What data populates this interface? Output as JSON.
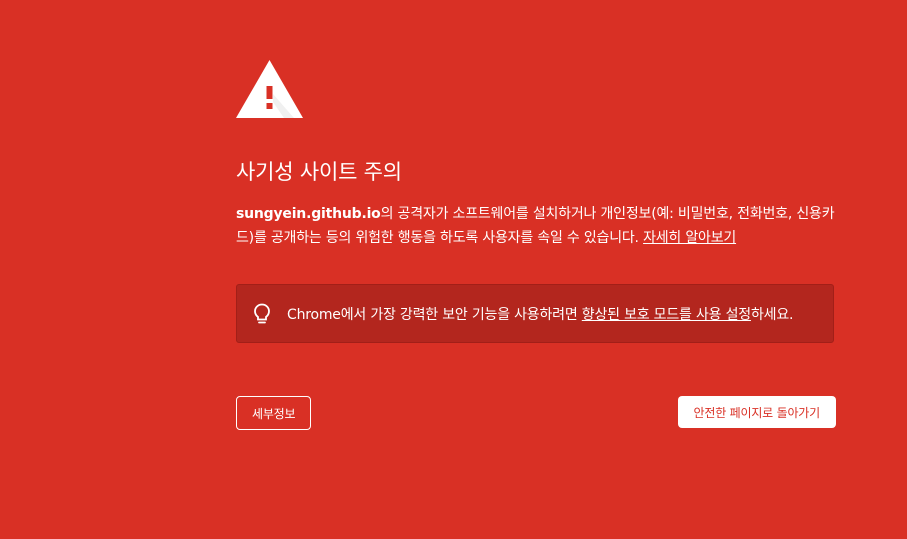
{
  "icon": "warning-triangle-icon",
  "heading": "사기성 사이트 주의",
  "description": {
    "domain": "sungyein.github.io",
    "text": "의 공격자가 소프트웨어를 설치하거나 개인정보(예: 비밀번호, 전화번호, 신용카드)를 공개하는 등의 위험한 행동을 하도록 사용자를 속일 수 있습니다. ",
    "learn_more": "자세히 알아보기"
  },
  "enhanced_protection": {
    "icon": "lightbulb-icon",
    "prefix": "Chrome에서 가장 강력한 보안 기능을 사용하려면 ",
    "link": "향상된 보호 모드를 사용 설정",
    "suffix": "하세요."
  },
  "buttons": {
    "details": "세부정보",
    "back_to_safety": "안전한 페이지로 돌아가기"
  },
  "colors": {
    "background": "#d93025",
    "notice_background": "#b3261e",
    "text": "#ffffff",
    "primary_button_text": "#d93025"
  }
}
